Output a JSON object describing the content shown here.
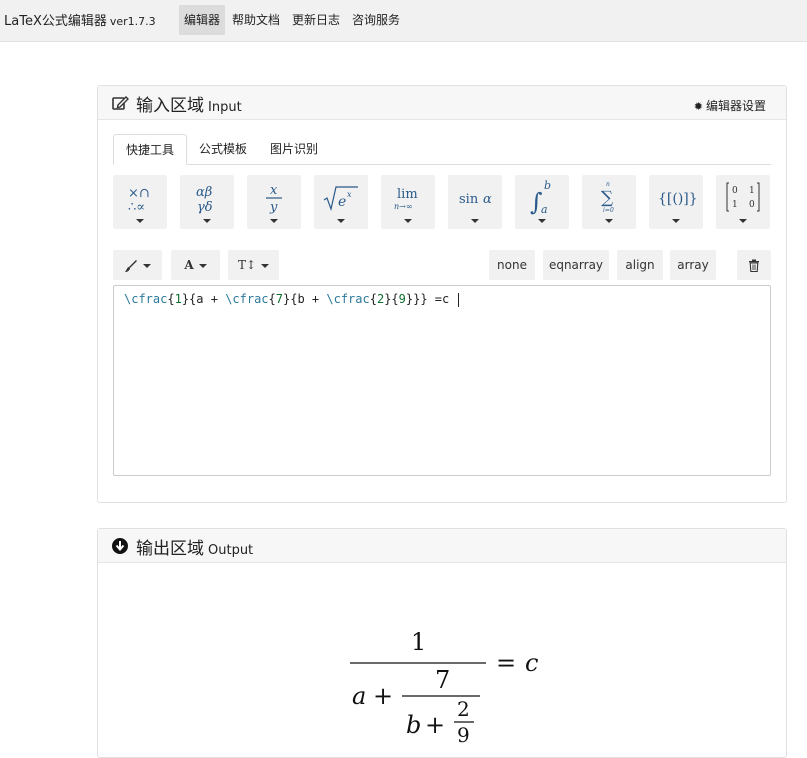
{
  "navbar": {
    "brand": "LaTeX公式编辑器",
    "version": "ver1.7.3",
    "items": [
      "编辑器",
      "帮助文档",
      "更新日志",
      "咨询服务"
    ]
  },
  "input_panel": {
    "title": "输入区域",
    "title_en": "Input",
    "settings": "编辑器设置",
    "tabs": [
      "快捷工具",
      "公式模板",
      "图片识别"
    ],
    "symbol_groups": [
      "operators-icon",
      "greek-letters-icon",
      "fraction-icon",
      "sqrt-icon",
      "limit-icon",
      "trig-icon",
      "integral-icon",
      "sum-icon",
      "brackets-icon",
      "matrix-icon"
    ],
    "toolbar": {
      "color_icon": "brush-icon",
      "font_label": "A",
      "size_label": "T↕",
      "env_options": [
        "none",
        "eqnarray",
        "align",
        "array"
      ],
      "delete_icon": "trash-icon"
    },
    "latex_code": "\\cfrac{1}{a + \\cfrac{7}{b + \\cfrac{2}{9}}} =c "
  },
  "output_panel": {
    "title": "输出区域",
    "title_en": "Output"
  },
  "formula": {
    "n1": "1",
    "a": "a",
    "plus1": "+",
    "n7": "7",
    "b": "b",
    "plus2": "+",
    "n2": "2",
    "n9": "9",
    "eq": "=",
    "c": "c"
  },
  "colors": {
    "navbar_bg": "#f1f1f1",
    "panel_head_bg": "#f7f7f7",
    "tool_bg": "#f1f1f1",
    "latex_command": "#2a7a9a",
    "latex_argument": "#0f6e2f"
  }
}
